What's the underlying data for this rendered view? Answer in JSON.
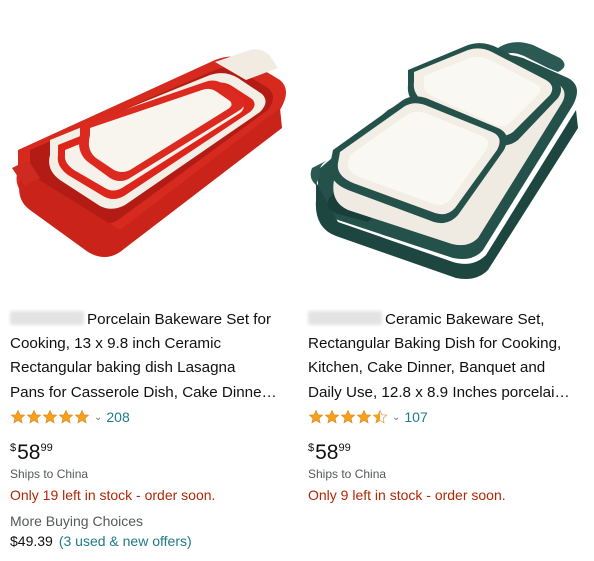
{
  "colors": {
    "link": "#1e7a8c",
    "stock": "#b12704",
    "star": "#f2a21b",
    "muted": "#565959"
  },
  "products": [
    {
      "image_icon": "red-ceramic-bakeware-set-image",
      "title_line1": "Porcelain Bakeware Set for",
      "title_line2": "Cooking, 13 x 9.8 inch Ceramic",
      "title_line3": "Rectangular baking dish Lasagna",
      "title_line4": "Pans for Casserole Dish, Cake Dinne…",
      "rating_stars": 5,
      "review_count": "208",
      "price_currency": "$",
      "price_whole": "58",
      "price_fraction": "99",
      "ships_to": "Ships to China",
      "stock_text": "Only 19 left in stock - order soon.",
      "more_buying_label": "More Buying Choices",
      "more_buying_price": "$49.39",
      "more_buying_offers": "(3 used & new offers)"
    },
    {
      "image_icon": "green-ceramic-bakeware-set-image",
      "title_line1": "Ceramic Bakeware Set,",
      "title_line2": "Rectangular Baking Dish for Cooking,",
      "title_line3": "Kitchen, Cake Dinner, Banquet and",
      "title_line4": "Daily Use, 12.8 x 8.9 Inches porcelai…",
      "rating_stars": 4.5,
      "review_count": "107",
      "price_currency": "$",
      "price_whole": "58",
      "price_fraction": "99",
      "ships_to": "Ships to China",
      "stock_text": "Only 9 left in stock - order soon."
    }
  ]
}
